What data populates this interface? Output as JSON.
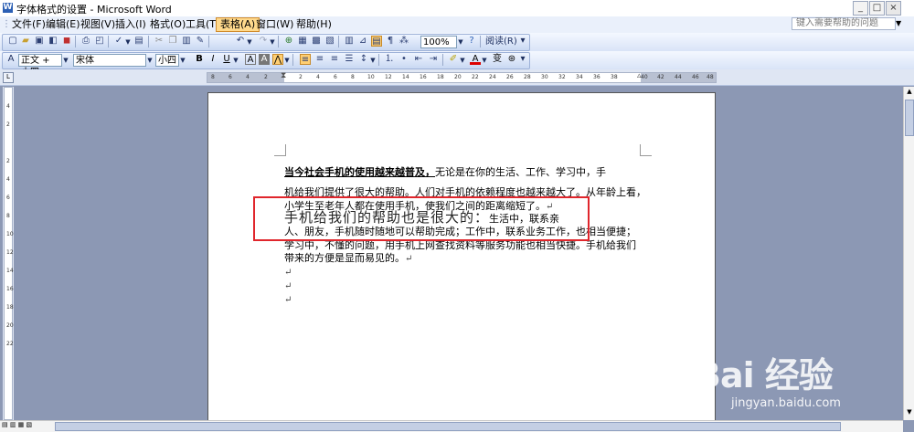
{
  "window": {
    "title": "字体格式的设置 - Microsoft Word",
    "app_icon": "W",
    "buttons": [
      "_",
      "□",
      "×"
    ]
  },
  "menu": {
    "items": [
      "文件(F)",
      "编辑(E)",
      "视图(V)",
      "插入(I)",
      "格式(O)",
      "工具(T)",
      "表格(A)",
      "窗口(W)",
      "帮助(H)"
    ],
    "active_index": 6,
    "help_placeholder": "键入需要帮助的问题"
  },
  "toolbar_standard": {
    "zoom": "100%",
    "read_label": "阅读(R)"
  },
  "toolbar_format": {
    "style": "正文 + 小四",
    "font": "宋体",
    "size": "小四"
  },
  "ruler": {
    "h_labels": [
      "8",
      "6",
      "4",
      "2",
      "",
      "2",
      "4",
      "6",
      "8",
      "10",
      "12",
      "14",
      "16",
      "18",
      "20",
      "22",
      "24",
      "26",
      "28",
      "30",
      "32",
      "34",
      "36",
      "38",
      "40",
      "42",
      "44",
      "46",
      "48"
    ],
    "v_labels": [
      "4",
      "2",
      "",
      "2",
      "4",
      "6",
      "8",
      "10",
      "12",
      "14",
      "16",
      "18",
      "20",
      "22"
    ]
  },
  "document": {
    "line1_bold": "当今社会手机的使用越来越普及，",
    "line1_rest": "无论是在你的生活、工作、学习中，手",
    "line2": "机给我们提供了很大的帮助。人们对手机的依赖程度也越来越大了。从年龄上看，",
    "line3": "小学生至老年人都在使用手机，使我们之间的距离缩短了。",
    "line4_big": "手机给我们的帮助也是很大的：",
    "line4_rest": "生活中，联系亲",
    "line5": "人、朋友，手机随时随地可以帮助完成；工作中，联系业务工作，也相当便捷；",
    "line6": "学习中，不懂的问题，用手机上网查找资料等服务功能也相当快捷。手机给我们",
    "line7": "带来的方便是显而易见的。",
    "para_mark": "↵"
  },
  "watermark": {
    "logo": "Bai 经验",
    "url": "jingyan.baidu.com"
  },
  "colors": {
    "highlight_box": "#e0262c",
    "active_menu": "#ffd98c"
  }
}
